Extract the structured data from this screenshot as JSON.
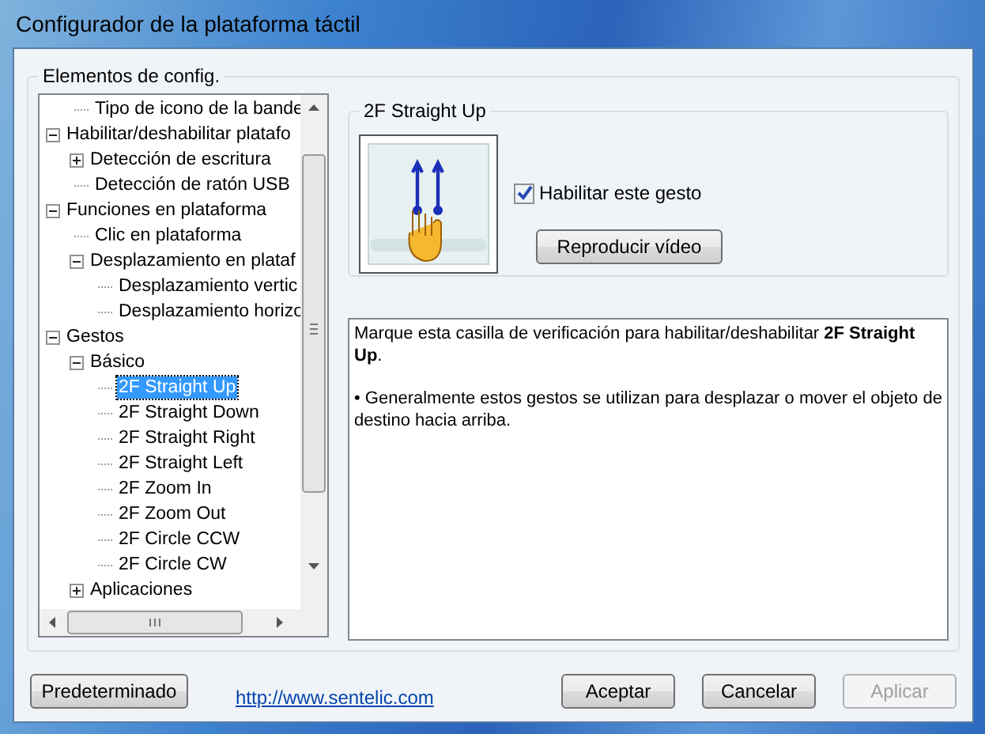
{
  "window": {
    "title": "Configurador de la plataforma táctil"
  },
  "settings_group": {
    "title": "Elementos de config."
  },
  "tree": {
    "items": [
      {
        "label": "Tipo de icono de la bande",
        "kind": "continued",
        "selected": false
      },
      {
        "label": "Habilitar/deshabilitar platafo",
        "kind": "node",
        "selected": false,
        "expanded": true,
        "children": [
          {
            "label": "Detección de escritura",
            "kind": "node",
            "selected": false,
            "expanded": false
          },
          {
            "label": "Detección de ratón USB",
            "kind": "leaf",
            "selected": false
          }
        ]
      },
      {
        "label": "Funciones en plataforma",
        "kind": "node",
        "selected": false,
        "expanded": true,
        "children": [
          {
            "label": "Clic en plataforma",
            "kind": "leaf",
            "selected": false
          },
          {
            "label": "Desplazamiento en plataf",
            "kind": "node",
            "selected": false,
            "expanded": true,
            "children": [
              {
                "label": "Desplazamiento vertic",
                "kind": "leaf",
                "selected": false
              },
              {
                "label": "Desplazamiento horizo",
                "kind": "leaf",
                "selected": false
              }
            ]
          }
        ]
      },
      {
        "label": "Gestos",
        "kind": "node",
        "selected": false,
        "expanded": true,
        "children": [
          {
            "label": "Básico",
            "kind": "node",
            "selected": false,
            "expanded": true,
            "children": [
              {
                "label": "2F Straight Up",
                "kind": "leaf",
                "selected": true
              },
              {
                "label": "2F Straight Down",
                "kind": "leaf",
                "selected": false
              },
              {
                "label": "2F Straight Right",
                "kind": "leaf",
                "selected": false
              },
              {
                "label": "2F Straight Left",
                "kind": "leaf",
                "selected": false
              },
              {
                "label": "2F Zoom In",
                "kind": "leaf",
                "selected": false
              },
              {
                "label": "2F Zoom Out",
                "kind": "leaf",
                "selected": false
              },
              {
                "label": "2F Circle CCW",
                "kind": "leaf",
                "selected": false
              },
              {
                "label": "2F Circle CW",
                "kind": "leaf",
                "selected": false
              }
            ]
          },
          {
            "label": "Aplicaciones",
            "kind": "node",
            "selected": false,
            "expanded": false
          }
        ]
      }
    ]
  },
  "gesture": {
    "title": "2F Straight Up",
    "enable": {
      "label": "Habilitar este gesto",
      "checked": true
    },
    "play_button": "Reproducir vídeo"
  },
  "description": {
    "paragraphs": [
      "Marque esta casilla de verificación para habilitar/deshabilitar **2F Straight Up**.",
      "• Generalmente estos gestos se utilizan para desplazar o mover el objeto de destino hacia arriba."
    ]
  },
  "footer": {
    "default_button": "Predeterminado",
    "link": "http://www.sentelic.com",
    "buttons": [
      {
        "label": "Aceptar",
        "disabled": false
      },
      {
        "label": "Cancelar",
        "disabled": false
      },
      {
        "label": "Aplicar",
        "disabled": true
      }
    ]
  }
}
